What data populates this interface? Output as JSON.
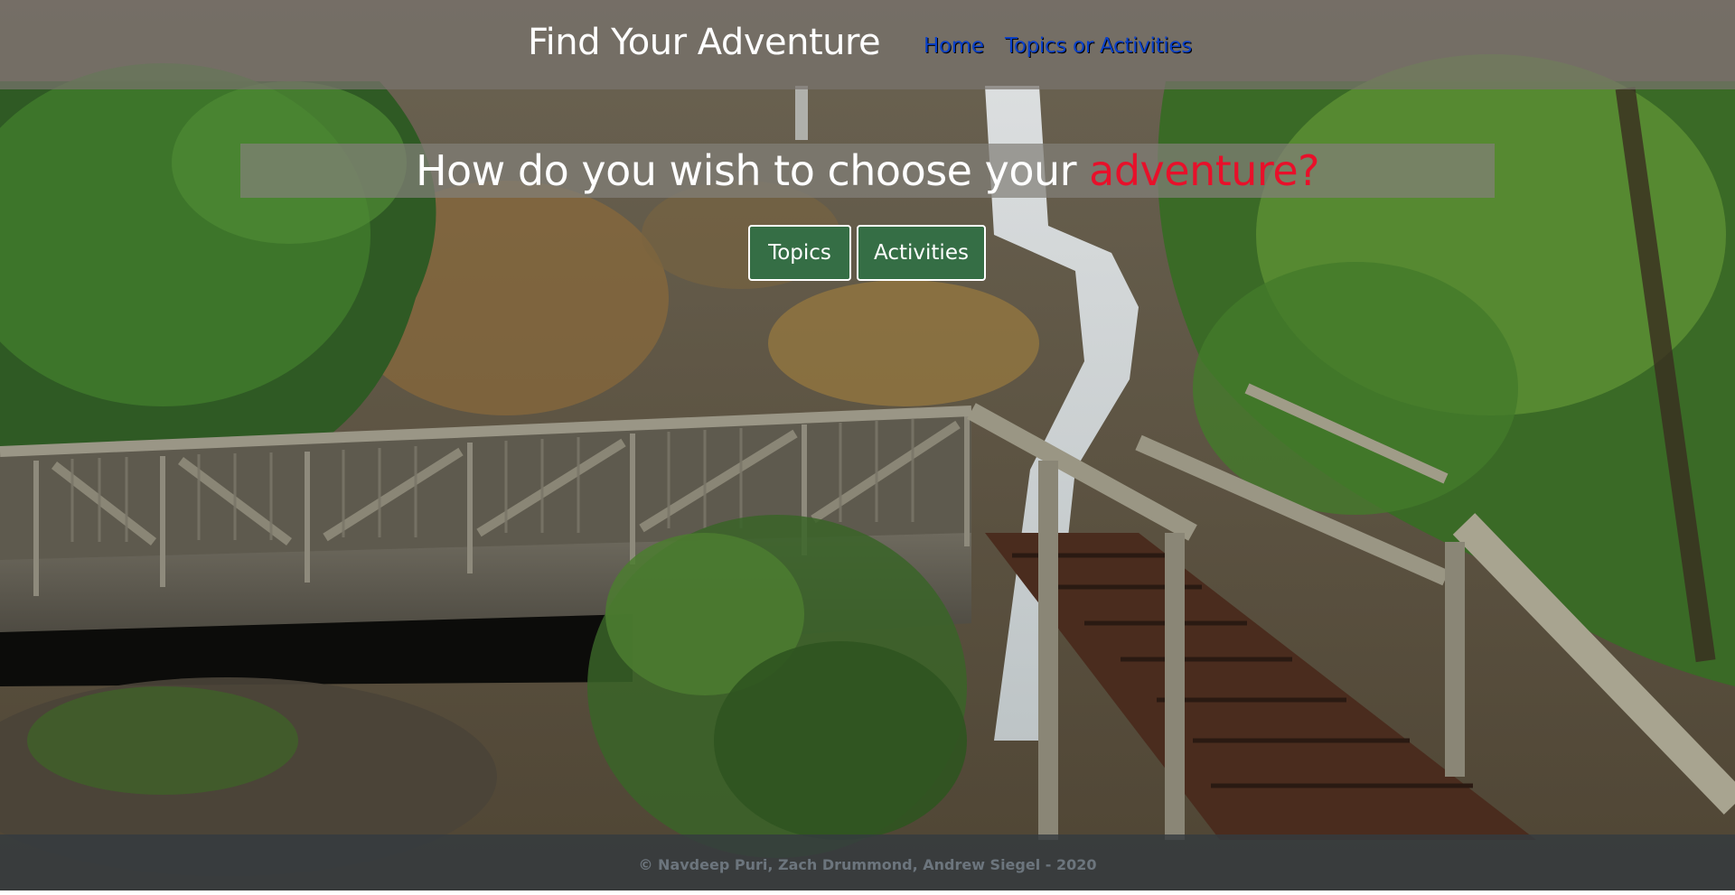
{
  "header": {
    "brand": "Find Your Adventure",
    "nav": [
      {
        "label": "Home"
      },
      {
        "label": "Topics or Activities"
      }
    ]
  },
  "hero": {
    "title_prefix": "How do you wish to choose your ",
    "title_accent": "adventure?",
    "buttons": [
      {
        "label": "Topics"
      },
      {
        "label": "Activities"
      }
    ]
  },
  "footer": {
    "text": "© Navdeep Puri, Zach Drummond, Andrew Siegel - 2020"
  },
  "colors": {
    "navbar": "#78736e",
    "nav_link": "#0a40c8",
    "accent": "#e8102a",
    "button": "#356e45",
    "footer": "#343a40",
    "footer_text": "#6c757d"
  },
  "background": {
    "subject": "waterfall-bridge-photo"
  }
}
